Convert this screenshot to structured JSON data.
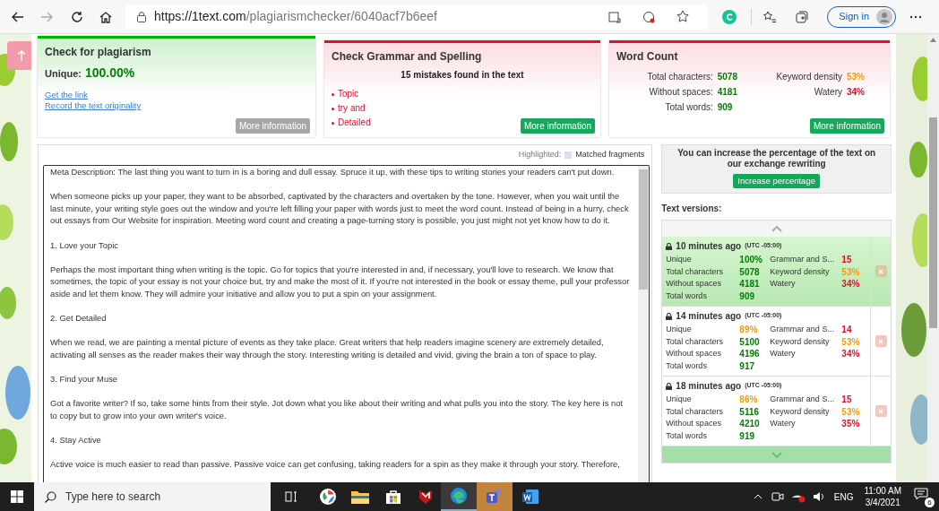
{
  "browser": {
    "url_host": "https://1text.com",
    "url_path": "/plagiarismchecker/6040acf7b6eef",
    "sign_in": "Sign in"
  },
  "plagiarism_card": {
    "title": "Check for plagiarism",
    "unique_label": "Unique:",
    "unique_value": "100.00%",
    "links": [
      "Get the link",
      "Record the text originality"
    ],
    "button": "More information"
  },
  "grammar_card": {
    "title": "Check Grammar and Spelling",
    "summary": "15 mistakes found in the text",
    "mistakes": [
      "Topic",
      "try and",
      "Detailed"
    ],
    "button": "More information"
  },
  "word_count_card": {
    "title": "Word Count",
    "stats": [
      {
        "label": "Total characters:",
        "value": "5078",
        "color": "#008000"
      },
      {
        "label": "Without spaces:",
        "value": "4181",
        "color": "#008000"
      },
      {
        "label": "Total words:",
        "value": "909",
        "color": "#008000"
      }
    ],
    "extra": [
      {
        "label": "Keyword density",
        "value": "53%",
        "color": "#ff9900"
      },
      {
        "label": "Watery",
        "value": "34%",
        "color": "#e0102a"
      }
    ],
    "button": "More information"
  },
  "legend": {
    "label": "Highlighted:",
    "item": "Matched fragments"
  },
  "text": [
    {
      "kind": "para",
      "text": "Meta Description: The last thing you want to turn in is a boring and dull essay. Spruce it up, with these tips to writing stories your readers can't put down."
    },
    {
      "kind": "para",
      "text": "When someone picks up your paper, they want to be absorbed, captivated by the characters and overtaken by the tone. However, when you wait until the last minute, your writing style goes out the window and you're left filling your paper with words just to meet the word count. Instead of being in a hurry, check out essays from Our Website for inspiration. Meeting word count and creating a page-turning story is possible, you just might not yet know how to do it."
    },
    {
      "kind": "para",
      "text": "1. Love your Topic"
    },
    {
      "kind": "para",
      "text": "Perhaps the most important thing when writing is the topic. Go for topics that you're interested in and, if necessary, you'll love to research. We know that sometimes, the topic of your essay is not your choice but, try and make the most of it. If you're not interested in the book or essay theme, pull your professor aside and let them know. They will admire your initiative and allow you to put a spin on your assignment."
    },
    {
      "kind": "para",
      "text": "2. Get Detailed"
    },
    {
      "kind": "para",
      "text": "When we read, we are painting a mental picture of events as they take place. Great writers that help readers imagine scenery are extremely detailed, activating all senses as the reader makes their way through the story. Interesting writing is detailed and vivid, giving the brain a ton of space to play."
    },
    {
      "kind": "para",
      "text": "3. Find your Muse"
    },
    {
      "kind": "para",
      "text": "Got a favorite writer? If so, take some hints from their style. Jot down what you like about their writing and what pulls you into the story. The key here is not to copy but to grow into your own writer's voice."
    },
    {
      "kind": "para",
      "text": "4. Stay Active"
    },
    {
      "kind": "para",
      "text": "Active voice is much easier to read than passive. Passive voice can get confusing, taking readers for a spin as they make it through your story. Therefore,"
    }
  ],
  "rewrite": {
    "text": "You can increase the percentage of the text on our exchange rewriting",
    "button": "Increase percentage"
  },
  "versions_title": "Text versions:",
  "versions": [
    {
      "time": "10 minutes ago",
      "tz": "(UTC -05:00)",
      "selected": true,
      "rows": [
        [
          {
            "label": "Unique",
            "value": "100%",
            "color": "#008000"
          },
          {
            "label": "Grammar and S...",
            "value": "15",
            "color": "#e0102a"
          }
        ],
        [
          {
            "label": "Total characters",
            "value": "5078",
            "color": "#008000"
          },
          {
            "label": "Keyword density",
            "value": "53%",
            "color": "#ff9900"
          }
        ],
        [
          {
            "label": "Without spaces",
            "value": "4181",
            "color": "#008000"
          },
          {
            "label": "Watery",
            "value": "34%",
            "color": "#e0102a"
          }
        ],
        [
          {
            "label": "Total words",
            "value": "909",
            "color": "#008000"
          }
        ]
      ]
    },
    {
      "time": "14 minutes ago",
      "tz": "(UTC -05:00)",
      "selected": false,
      "rows": [
        [
          {
            "label": "Unique",
            "value": "89%",
            "color": "#ff9900"
          },
          {
            "label": "Grammar and S...",
            "value": "14",
            "color": "#e0102a"
          }
        ],
        [
          {
            "label": "Total characters",
            "value": "5100",
            "color": "#008000"
          },
          {
            "label": "Keyword density",
            "value": "53%",
            "color": "#ff9900"
          }
        ],
        [
          {
            "label": "Without spaces",
            "value": "4196",
            "color": "#008000"
          },
          {
            "label": "Watery",
            "value": "34%",
            "color": "#e0102a"
          }
        ],
        [
          {
            "label": "Total words",
            "value": "917",
            "color": "#008000"
          }
        ]
      ]
    },
    {
      "time": "18 minutes ago",
      "tz": "(UTC -05:00)",
      "selected": false,
      "rows": [
        [
          {
            "label": "Unique",
            "value": "86%",
            "color": "#ff9900"
          },
          {
            "label": "Grammar and S...",
            "value": "15",
            "color": "#e0102a"
          }
        ],
        [
          {
            "label": "Total characters",
            "value": "5116",
            "color": "#008000"
          },
          {
            "label": "Keyword density",
            "value": "53%",
            "color": "#ff9900"
          }
        ],
        [
          {
            "label": "Without spaces",
            "value": "4210",
            "color": "#008000"
          },
          {
            "label": "Watery",
            "value": "35%",
            "color": "#e0102a"
          }
        ],
        [
          {
            "label": "Total words",
            "value": "919",
            "color": "#008000"
          }
        ]
      ]
    }
  ],
  "taskbar": {
    "search_placeholder": "Type here to search",
    "language": "ENG",
    "time": "11:00 AM",
    "date": "3/4/2021",
    "notifications": "6"
  }
}
